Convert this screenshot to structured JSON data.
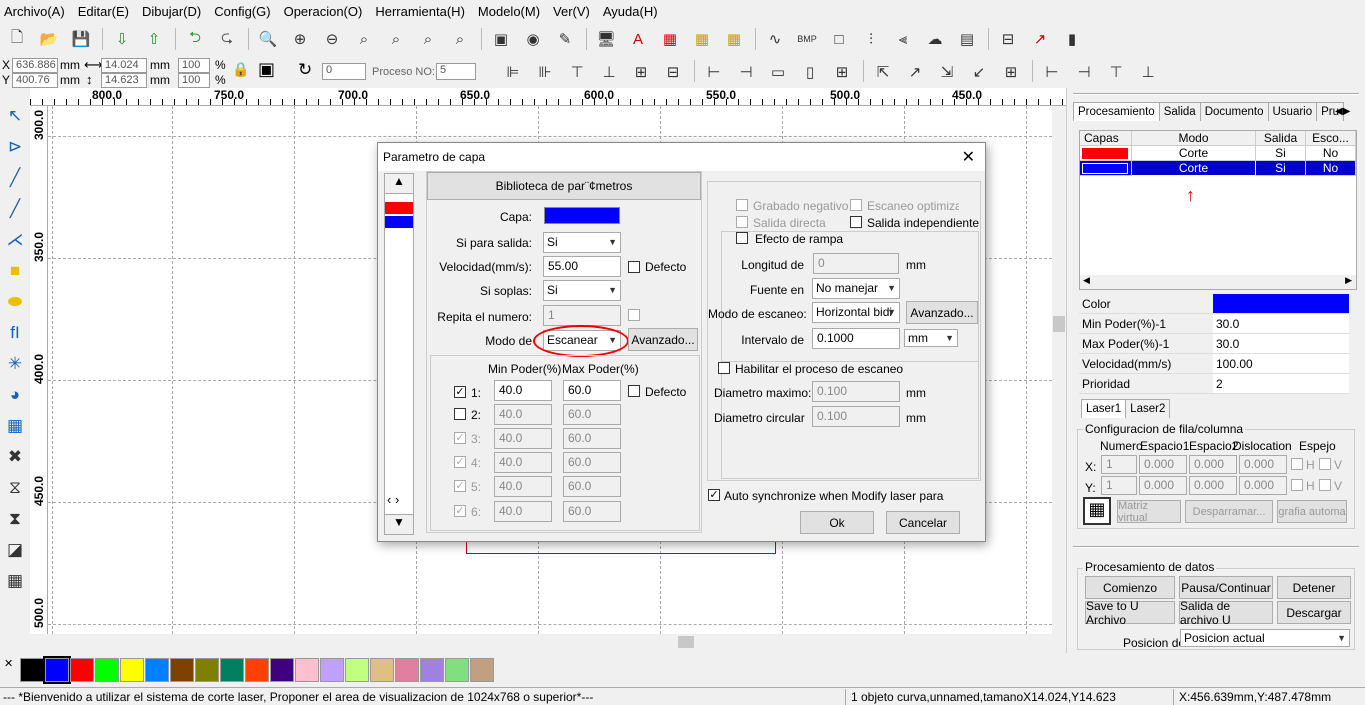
{
  "menu": [
    "Archivo(A)",
    "Editar(E)",
    "Dibujar(D)",
    "Config(G)",
    "Operacion(O)",
    "Herramienta(H)",
    "Modelo(M)",
    "Ver(V)",
    "Ayuda(H)"
  ],
  "coords": {
    "x_label": "X",
    "x_val": "636.886",
    "y_label": "Y",
    "y_val": "400.76",
    "unit": "mm",
    "w_val": "14.024",
    "h_val": "14.623",
    "pct_w": "100",
    "pct_h": "100",
    "pct": "%",
    "rot_val": "0",
    "proceso_label": "Proceso NO:",
    "proceso_val": "5"
  },
  "ruler_h": [
    "800.0",
    "750.0",
    "700.0",
    "650.0",
    "600.0",
    "550.0",
    "500.0",
    "450.0"
  ],
  "ruler_v": [
    "300.0",
    "350.0",
    "400.0",
    "450.0",
    "500.0"
  ],
  "dialog": {
    "title": "Parametro de capa",
    "library_btn": "Biblioteca de par¨¢metros",
    "capa_label": "Capa:",
    "capa_color": "#0000ff",
    "salida_label": "Si para salida:",
    "salida_val": "Si",
    "velocidad_label": "Velocidad(mm/s):",
    "velocidad_val": "55.00",
    "defecto1": "Defecto",
    "soplas_label": "Si soplas:",
    "soplas_val": "Si",
    "repita_label": "Repita el numero:",
    "repita_val": "1",
    "modo_label": "Modo de",
    "modo_val": "Escanear",
    "avanzado1": "Avanzado...",
    "min_hdr": "Min Poder(%)",
    "max_hdr": "Max Poder(%)",
    "defecto2": "Defecto",
    "power_rows": [
      {
        "label": "1:",
        "min": "40.0",
        "max": "60.0"
      },
      {
        "label": "2:",
        "min": "40.0",
        "max": "60.0"
      },
      {
        "label": "3:",
        "min": "40.0",
        "max": "60.0"
      },
      {
        "label": "4:",
        "min": "40.0",
        "max": "60.0"
      },
      {
        "label": "5:",
        "min": "40.0",
        "max": "60.0"
      },
      {
        "label": "6:",
        "min": "40.0",
        "max": "60.0"
      }
    ],
    "grabado_neg": "Grabado negativo",
    "escaneo_opt": "Escaneo optimizado",
    "salida_directa": "Salida directa",
    "salida_indep": "Salida independiente",
    "efecto_rampa": "Efecto de rampa",
    "longitud_label": "Longitud de",
    "longitud_val": "0",
    "mm": "mm",
    "fuente_label": "Fuente en",
    "fuente_val": "No manejar",
    "modo_esc_label": "Modo de escaneo:",
    "modo_esc_val": "Horizontal bidi",
    "avanzado2": "Avanzado...",
    "intervalo_label": "Intervalo de",
    "intervalo_val": "0.1000",
    "intervalo_unit": "mm",
    "habilitar": "Habilitar el proceso de escaneo",
    "diam_max_label": "Diametro maximo:",
    "diam_max_val": "0.100",
    "diam_circ_label": "Diametro circular",
    "diam_circ_val": "0.100",
    "auto_sync": "Auto synchronize when Modify laser para",
    "ok": "Ok",
    "cancel": "Cancelar",
    "nav": "‹ ›"
  },
  "right": {
    "tabs": [
      "Procesamiento",
      "Salida",
      "Documento",
      "Usuario",
      "Pru"
    ],
    "table_headers": [
      "Capas",
      "Modo",
      "Salida",
      "Esco..."
    ],
    "rows": [
      {
        "color": "#ff0000",
        "modo": "Corte",
        "salida": "Si",
        "esco": "No"
      },
      {
        "color": "#0000ff",
        "modo": "Corte",
        "salida": "Si",
        "esco": "No"
      }
    ],
    "props": [
      {
        "k": "Color",
        "v": ""
      },
      {
        "k": "Min Poder(%)-1",
        "v": "30.0"
      },
      {
        "k": "Max Poder(%)-1",
        "v": "30.0"
      },
      {
        "k": "Velocidad(mm/s)",
        "v": "100.00"
      },
      {
        "k": "Prioridad",
        "v": "2"
      }
    ],
    "laser_tabs": [
      "Laser1",
      "Laser2"
    ],
    "config_title": "Configuracion de fila/columna",
    "config_hdrs": [
      "Numero",
      "Espacio1",
      "Espacio2",
      "Dislocation",
      "Espejo"
    ],
    "x_row": {
      "label": "X:",
      "n": "1",
      "e1": "0.000",
      "e2": "0.000",
      "d": "0.000",
      "h": "H",
      "v": "V"
    },
    "y_row": {
      "label": "Y:",
      "n": "1",
      "e1": "0.000",
      "e2": "0.000",
      "d": "0.000",
      "h": "H",
      "v": "V"
    },
    "btns": [
      "Matriz virtual",
      "Desparramar...",
      "grafia automa"
    ],
    "data_title": "Procesamiento de datos",
    "data_btns": [
      "Comienzo",
      "Pausa/Continuar",
      "Detener",
      "Save to U Archivo",
      "Salida de archivo U",
      "Descargar"
    ],
    "posicion_label": "Posicion de",
    "posicion_val": "Posicion actual"
  },
  "palette": [
    "#000000",
    "#0000ff",
    "#ff0000",
    "#00ff00",
    "#ffff00",
    "#0080ff",
    "#804000",
    "#808000",
    "#008060",
    "#ff4000",
    "#400080",
    "#ffc0d0",
    "#c0a0ff",
    "#c0ff80",
    "#e0c080",
    "#e080a0",
    "#a080e0",
    "#80e080",
    "#c0a080"
  ],
  "status": {
    "left": "--- *Bienvenido a utilizar el sistema de corte laser, Proponer el area de visualizacion de 1024x768 o superior*---",
    "mid": "1 objeto curva,unnamed,tamanoX14.024,Y14.623",
    "right": "X:456.639mm,Y:487.478mm"
  }
}
